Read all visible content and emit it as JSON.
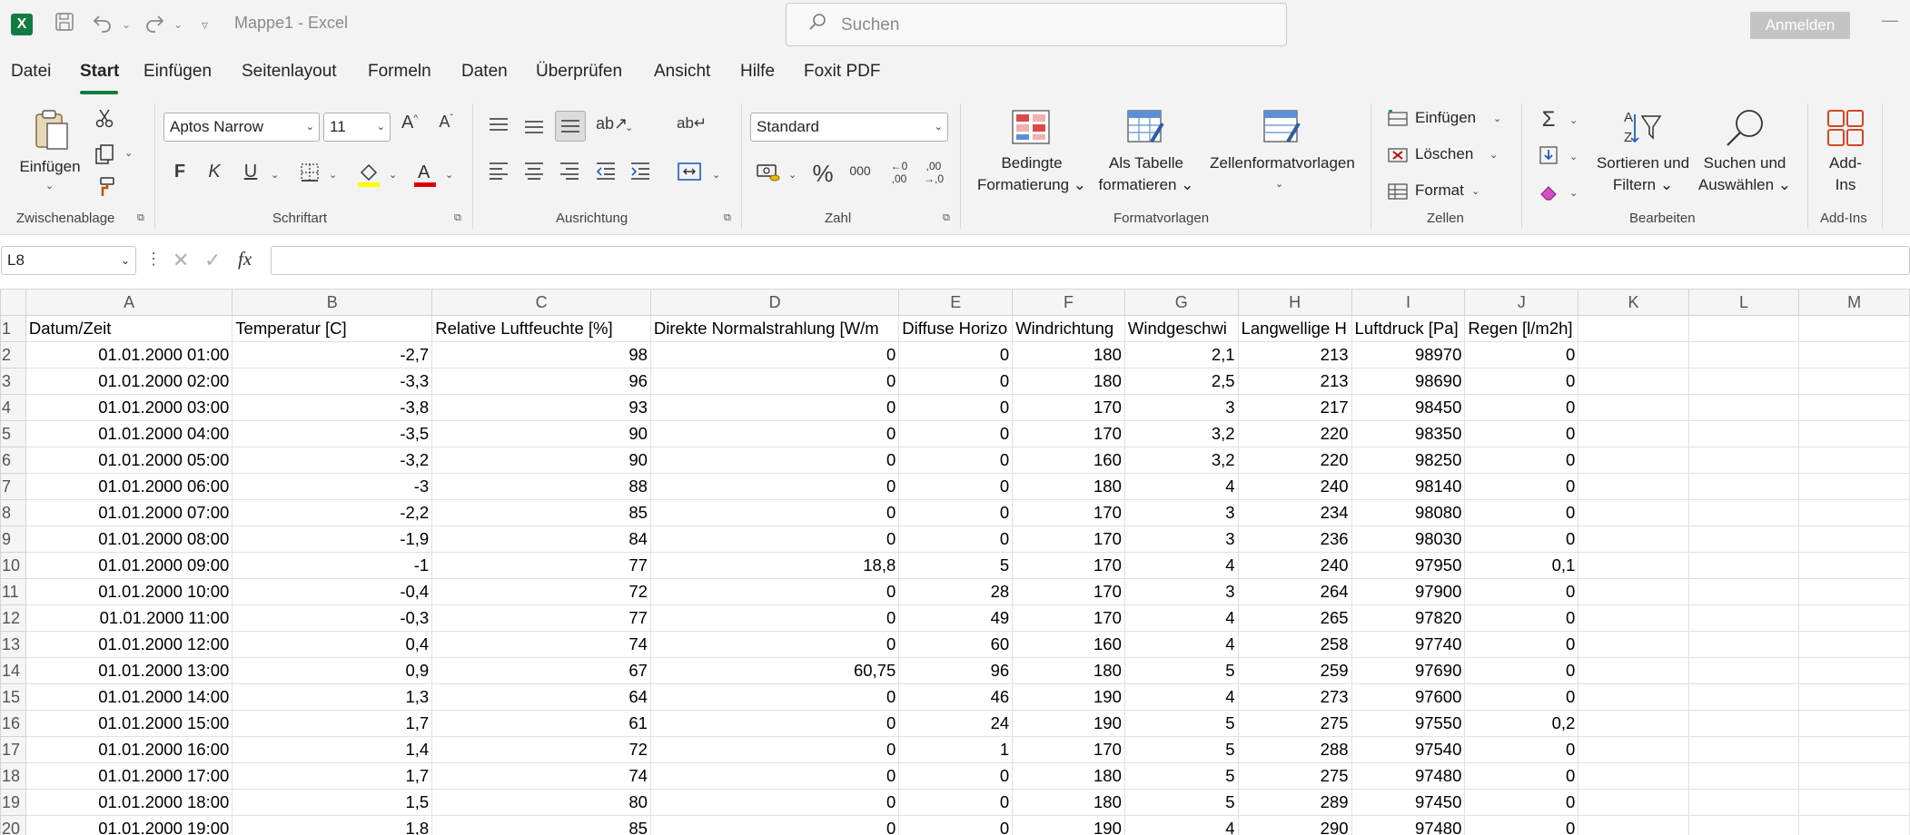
{
  "title_bar": {
    "app_logo": "X",
    "doc_title": "Mappe1  -  Excel",
    "search_placeholder": "Suchen",
    "signin_label": "Anmelden",
    "icons": [
      "excel-logo-icon",
      "save-icon",
      "undo-icon",
      "redo-icon",
      "customize-qat-icon",
      "search-icon",
      "minimize-icon"
    ]
  },
  "menu": {
    "tabs": [
      "Datei",
      "Start",
      "Einfügen",
      "Seitenlayout",
      "Formeln",
      "Daten",
      "Überprüfen",
      "Ansicht",
      "Hilfe",
      "Foxit PDF"
    ],
    "active": "Start",
    "accent_color": "#107c41"
  },
  "ribbon": {
    "clipboard": {
      "paste_label": "Einfügen",
      "group_label": "Zwischenablage"
    },
    "font": {
      "font_name": "Aptos Narrow",
      "font_size": "11",
      "bold": "F",
      "italic": "K",
      "underline": "U",
      "group_label": "Schriftart"
    },
    "alignment": {
      "group_label": "Ausrichtung"
    },
    "number": {
      "format": "Standard",
      "group_label": "Zahl",
      "percent": "%",
      "thousands": "000"
    },
    "styles": {
      "conditional": [
        "Bedingte",
        "Formatierung ⌄"
      ],
      "as_table": [
        "Als Tabelle",
        "formatieren ⌄"
      ],
      "cell_styles": "Zellenformatvorlagen",
      "group_label": "Formatvorlagen"
    },
    "cells": {
      "insert": "Einfügen",
      "delete": "Löschen",
      "format": "Format",
      "group_label": "Zellen"
    },
    "editing": {
      "sort_filter": [
        "Sortieren und",
        "Filtern ⌄"
      ],
      "find_select": [
        "Suchen und",
        "Auswählen ⌄"
      ],
      "group_label": "Bearbeiten"
    },
    "addins": {
      "label": [
        "Add-",
        "Ins"
      ],
      "group_label": "Add-Ins"
    }
  },
  "formula_bar": {
    "name_box": "L8",
    "fx": "fx",
    "value": ""
  },
  "sheet": {
    "columns": [
      "A",
      "B",
      "C",
      "D",
      "E",
      "F",
      "G",
      "H",
      "I",
      "J",
      "K",
      "L",
      "M"
    ],
    "header_row": [
      "Datum/Zeit",
      "Temperatur [C]",
      "Relative Luftfeuchte [%]",
      "Direkte Normalstrahlung [W/m",
      "Diffuse Horizo",
      "Windrichtung",
      "Windgeschwi",
      "Langwellige H",
      "Luftdruck [Pa]",
      "Regen [l/m2h]",
      "",
      "",
      ""
    ],
    "rows": [
      [
        "01.01.2000 01:00",
        "-2,7",
        "98",
        "0",
        "0",
        "180",
        "2,1",
        "213",
        "98970",
        "0"
      ],
      [
        "01.01.2000 02:00",
        "-3,3",
        "96",
        "0",
        "0",
        "180",
        "2,5",
        "213",
        "98690",
        "0"
      ],
      [
        "01.01.2000 03:00",
        "-3,8",
        "93",
        "0",
        "0",
        "170",
        "3",
        "217",
        "98450",
        "0"
      ],
      [
        "01.01.2000 04:00",
        "-3,5",
        "90",
        "0",
        "0",
        "170",
        "3,2",
        "220",
        "98350",
        "0"
      ],
      [
        "01.01.2000 05:00",
        "-3,2",
        "90",
        "0",
        "0",
        "160",
        "3,2",
        "220",
        "98250",
        "0"
      ],
      [
        "01.01.2000 06:00",
        "-3",
        "88",
        "0",
        "0",
        "180",
        "4",
        "240",
        "98140",
        "0"
      ],
      [
        "01.01.2000 07:00",
        "-2,2",
        "85",
        "0",
        "0",
        "170",
        "3",
        "234",
        "98080",
        "0"
      ],
      [
        "01.01.2000 08:00",
        "-1,9",
        "84",
        "0",
        "0",
        "170",
        "3",
        "236",
        "98030",
        "0"
      ],
      [
        "01.01.2000 09:00",
        "-1",
        "77",
        "18,8",
        "5",
        "170",
        "4",
        "240",
        "97950",
        "0,1"
      ],
      [
        "01.01.2000 10:00",
        "-0,4",
        "72",
        "0",
        "28",
        "170",
        "3",
        "264",
        "97900",
        "0"
      ],
      [
        "01.01.2000 11:00",
        "-0,3",
        "77",
        "0",
        "49",
        "170",
        "4",
        "265",
        "97820",
        "0"
      ],
      [
        "01.01.2000 12:00",
        "0,4",
        "74",
        "0",
        "60",
        "160",
        "4",
        "258",
        "97740",
        "0"
      ],
      [
        "01.01.2000 13:00",
        "0,9",
        "67",
        "60,75",
        "96",
        "180",
        "5",
        "259",
        "97690",
        "0"
      ],
      [
        "01.01.2000 14:00",
        "1,3",
        "64",
        "0",
        "46",
        "190",
        "4",
        "273",
        "97600",
        "0"
      ],
      [
        "01.01.2000 15:00",
        "1,7",
        "61",
        "0",
        "24",
        "190",
        "5",
        "275",
        "97550",
        "0,2"
      ],
      [
        "01.01.2000 16:00",
        "1,4",
        "72",
        "0",
        "1",
        "170",
        "5",
        "288",
        "97540",
        "0"
      ],
      [
        "01.01.2000 17:00",
        "1,7",
        "74",
        "0",
        "0",
        "180",
        "5",
        "275",
        "97480",
        "0"
      ],
      [
        "01.01.2000 18:00",
        "1,5",
        "80",
        "0",
        "0",
        "180",
        "5",
        "289",
        "97450",
        "0"
      ],
      [
        "01.01.2000 19:00",
        "1,8",
        "85",
        "0",
        "0",
        "190",
        "4",
        "290",
        "97480",
        "0"
      ]
    ]
  }
}
